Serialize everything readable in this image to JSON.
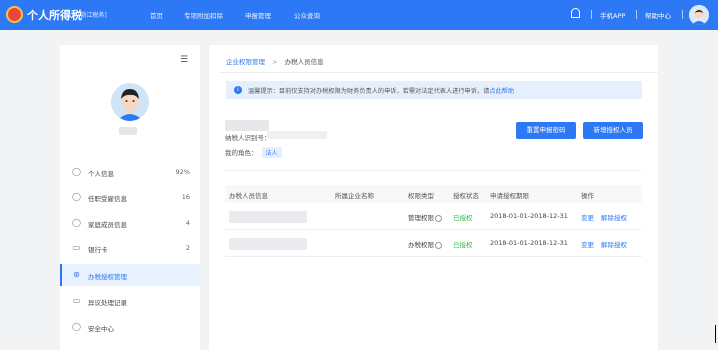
{
  "header": {
    "brand": "个人所得税",
    "region": "[浙江税务]",
    "nav": [
      {
        "label": "首页"
      },
      {
        "label": "专项附加扣除"
      },
      {
        "label": "申报管理"
      },
      {
        "label": "公众查询"
      }
    ],
    "right_links": [
      {
        "label": "手机APP"
      },
      {
        "label": "帮助中心"
      }
    ],
    "icons": [
      "bell-icon",
      "user-avatar"
    ]
  },
  "sidebar": {
    "menu_icon": "☰",
    "items": [
      {
        "label": "个人信息",
        "count": "92%",
        "icon": "person-icon"
      },
      {
        "label": "任职受雇信息",
        "count": "16",
        "icon": "person-tie-icon"
      },
      {
        "label": "家庭成员信息",
        "count": "4",
        "icon": "family-icon"
      },
      {
        "label": "银行卡",
        "count": "2",
        "icon": "card-icon"
      },
      {
        "label": "办税授权管理",
        "count": "",
        "icon": "org-icon",
        "active": true
      },
      {
        "label": "异议处理记录",
        "count": "",
        "icon": "folder-icon"
      },
      {
        "label": "安全中心",
        "count": "",
        "icon": "shield-icon"
      }
    ]
  },
  "breadcrumb": {
    "parent": "企业权限管理",
    "sep": ">",
    "current": "办税人员信息"
  },
  "notice": {
    "icon": "i",
    "text": "温馨提示：目前仅支持对办税权限为财务负责人的申诉，若需对法定代表人进行申诉，请",
    "link": "点此帮助"
  },
  "company": {
    "taxid_label": "纳税人识别号：",
    "role_label": "我的角色：",
    "role_value": "法人"
  },
  "buttons": {
    "reset_pwd": "重置申报密码",
    "add_person": "新增授权人员"
  },
  "table": {
    "headers": [
      "办税人员信息",
      "所属企业名称",
      "权限类型",
      "授权状态",
      "申请授权期限",
      "操作"
    ],
    "rows": [
      {
        "perm": "管理权限",
        "status": "已授权",
        "period": "2018-01-01-2018-12-31",
        "actions": [
          "变更",
          "解除授权"
        ]
      },
      {
        "perm": "办税权限",
        "status": "已授权",
        "period": "2018-01-01-2018-12-31",
        "actions": [
          "变更",
          "解除授权"
        ]
      }
    ]
  },
  "colors": {
    "primary": "#2d78f4",
    "success": "#39b54a",
    "background": "#f2f3f5"
  }
}
